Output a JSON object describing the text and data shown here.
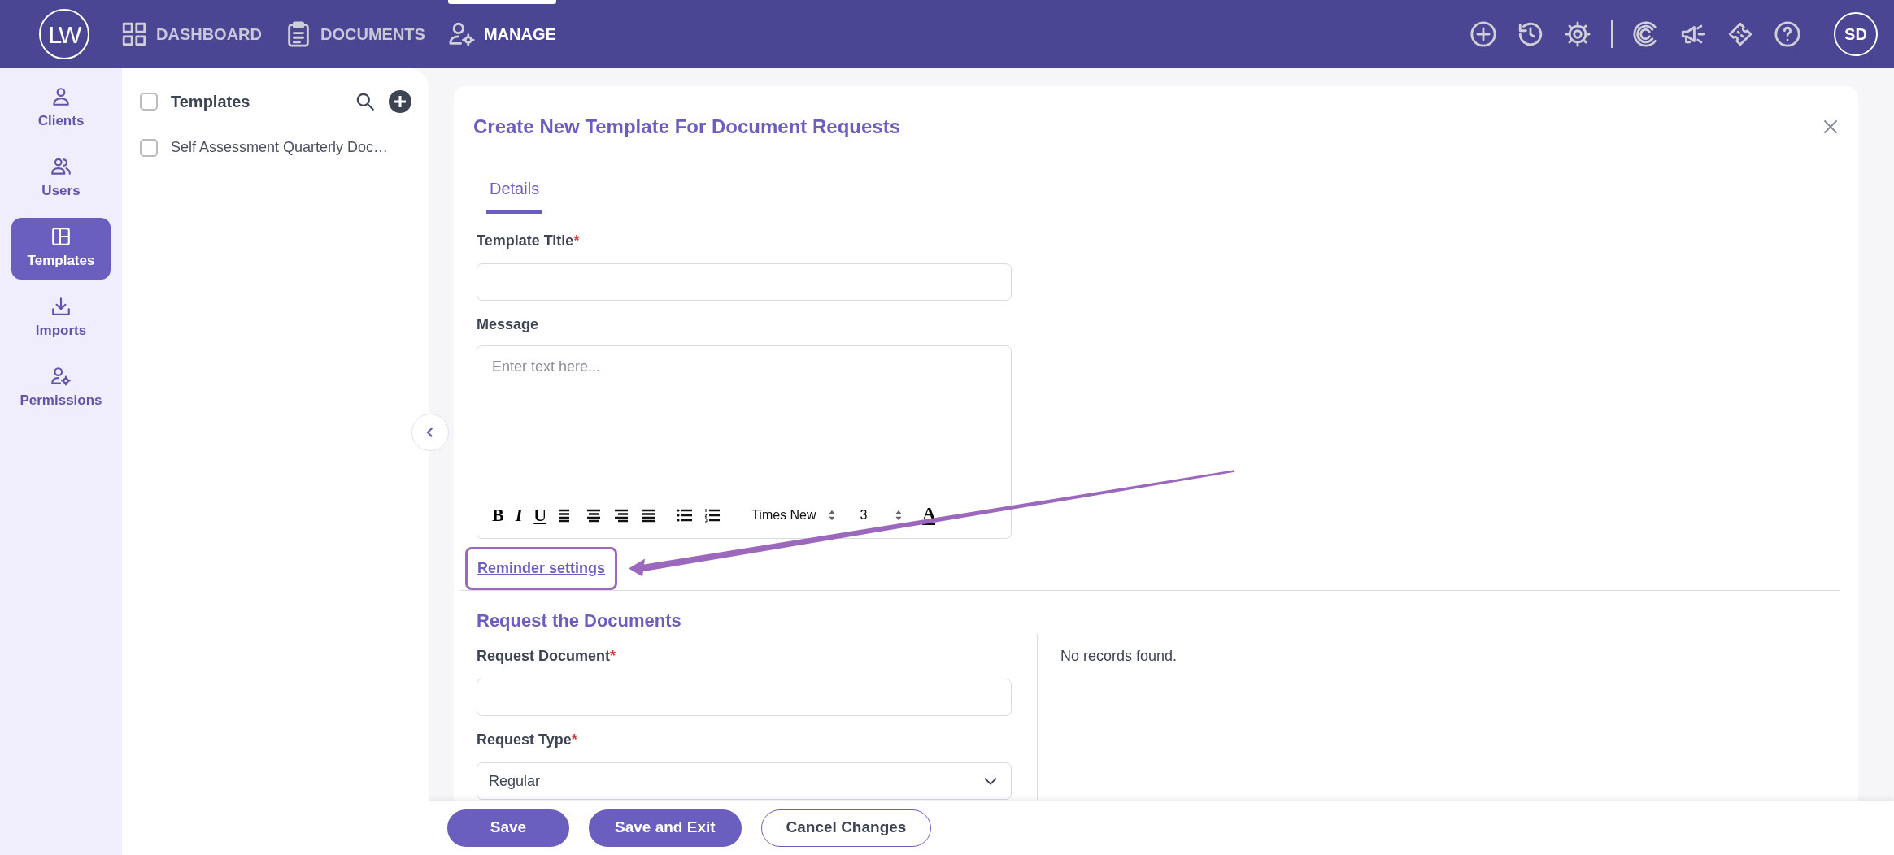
{
  "app": {
    "logo": "LW",
    "user_initials": "SD"
  },
  "top_nav": [
    {
      "label": "DASHBOARD",
      "selected": false
    },
    {
      "label": "DOCUMENTS",
      "selected": false
    },
    {
      "label": "MANAGE",
      "selected": true
    }
  ],
  "side_nav": [
    {
      "label": "Clients",
      "selected": false
    },
    {
      "label": "Users",
      "selected": false
    },
    {
      "label": "Templates",
      "selected": true
    },
    {
      "label": "Imports",
      "selected": false
    },
    {
      "label": "Permissions",
      "selected": false
    }
  ],
  "templates_panel": {
    "title": "Templates",
    "checked": false,
    "items": [
      {
        "label": "Self Assessment Quarterly Doc…",
        "checked": false
      }
    ]
  },
  "form": {
    "title": "Create New Template For Document Requests",
    "tabs": [
      {
        "label": "Details",
        "selected": true
      }
    ],
    "template_title": {
      "label": "Template Title",
      "required_mark": "*"
    },
    "message": {
      "label": "Message",
      "placeholder": "Enter text here...",
      "toolbar": {
        "bold": "B",
        "italic": "I",
        "underline": "U",
        "font": "Times New",
        "size": "3",
        "font_color_glyph": "A"
      }
    },
    "reminder_link": "Reminder settings",
    "section_title": "Request the Documents",
    "request_document": {
      "label": "Request Document",
      "required_mark": "*"
    },
    "request_type": {
      "label": "Request Type",
      "required_mark": "*",
      "value": "Regular"
    },
    "records_message": "No records found."
  },
  "buttons": [
    {
      "label": "Save",
      "kind": "primary"
    },
    {
      "label": "Save and Exit",
      "kind": "primary"
    },
    {
      "label": "Cancel Changes",
      "kind": "outline"
    }
  ]
}
